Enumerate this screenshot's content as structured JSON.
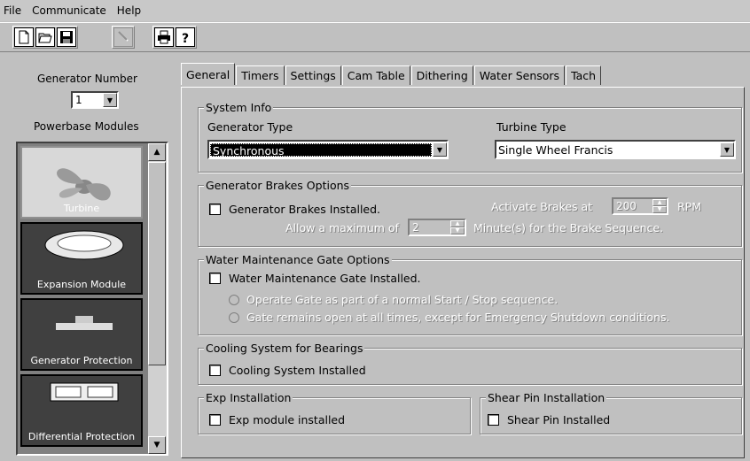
{
  "menu": {
    "file": "File",
    "communicate": "Communicate",
    "help": "Help"
  },
  "toolbar": {
    "icons": [
      "new-icon",
      "open-icon",
      "save-icon",
      "pointer-icon",
      "print-icon",
      "help-icon"
    ]
  },
  "left": {
    "generator_number_label": "Generator Number",
    "generator_number_value": "1",
    "powerbase_modules_label": "Powerbase Modules",
    "modules": [
      {
        "label": "Turbine"
      },
      {
        "label": "Expansion Module"
      },
      {
        "label": "Generator Protection"
      },
      {
        "label": "Differential Protection"
      }
    ]
  },
  "tabs": [
    "General",
    "Timers",
    "Settings",
    "Cam Table",
    "Dithering",
    "Water Sensors",
    "Tach"
  ],
  "system_info": {
    "title": "System Info",
    "generator_type_label": "Generator Type",
    "generator_type_value": "Synchronous",
    "turbine_type_label": "Turbine Type",
    "turbine_type_value": "Single Wheel Francis"
  },
  "brakes": {
    "title": "Generator Brakes Options",
    "installed_label": "Generator Brakes Installed.",
    "activate_label": "Activate Brakes at",
    "activate_value": "200",
    "rpm_label": "RPM",
    "allow_label": "Allow a maximum of",
    "allow_value": "2",
    "minutes_label": "Minute(s) for the Brake Sequence."
  },
  "water_gate": {
    "title": "Water Maintenance Gate Options",
    "installed_label": "Water Maintenance Gate Installed.",
    "option1": "Operate Gate as part of a normal Start / Stop sequence.",
    "option2": "Gate remains open at all times, except for Emergency Shutdown conditions."
  },
  "cooling": {
    "title": "Cooling System for Bearings",
    "installed_label": "Cooling System Installed"
  },
  "exp": {
    "title": "Exp Installation",
    "installed_label": "Exp module installed"
  },
  "shear": {
    "title": "Shear Pin Installation",
    "installed_label": "Shear Pin Installed"
  }
}
